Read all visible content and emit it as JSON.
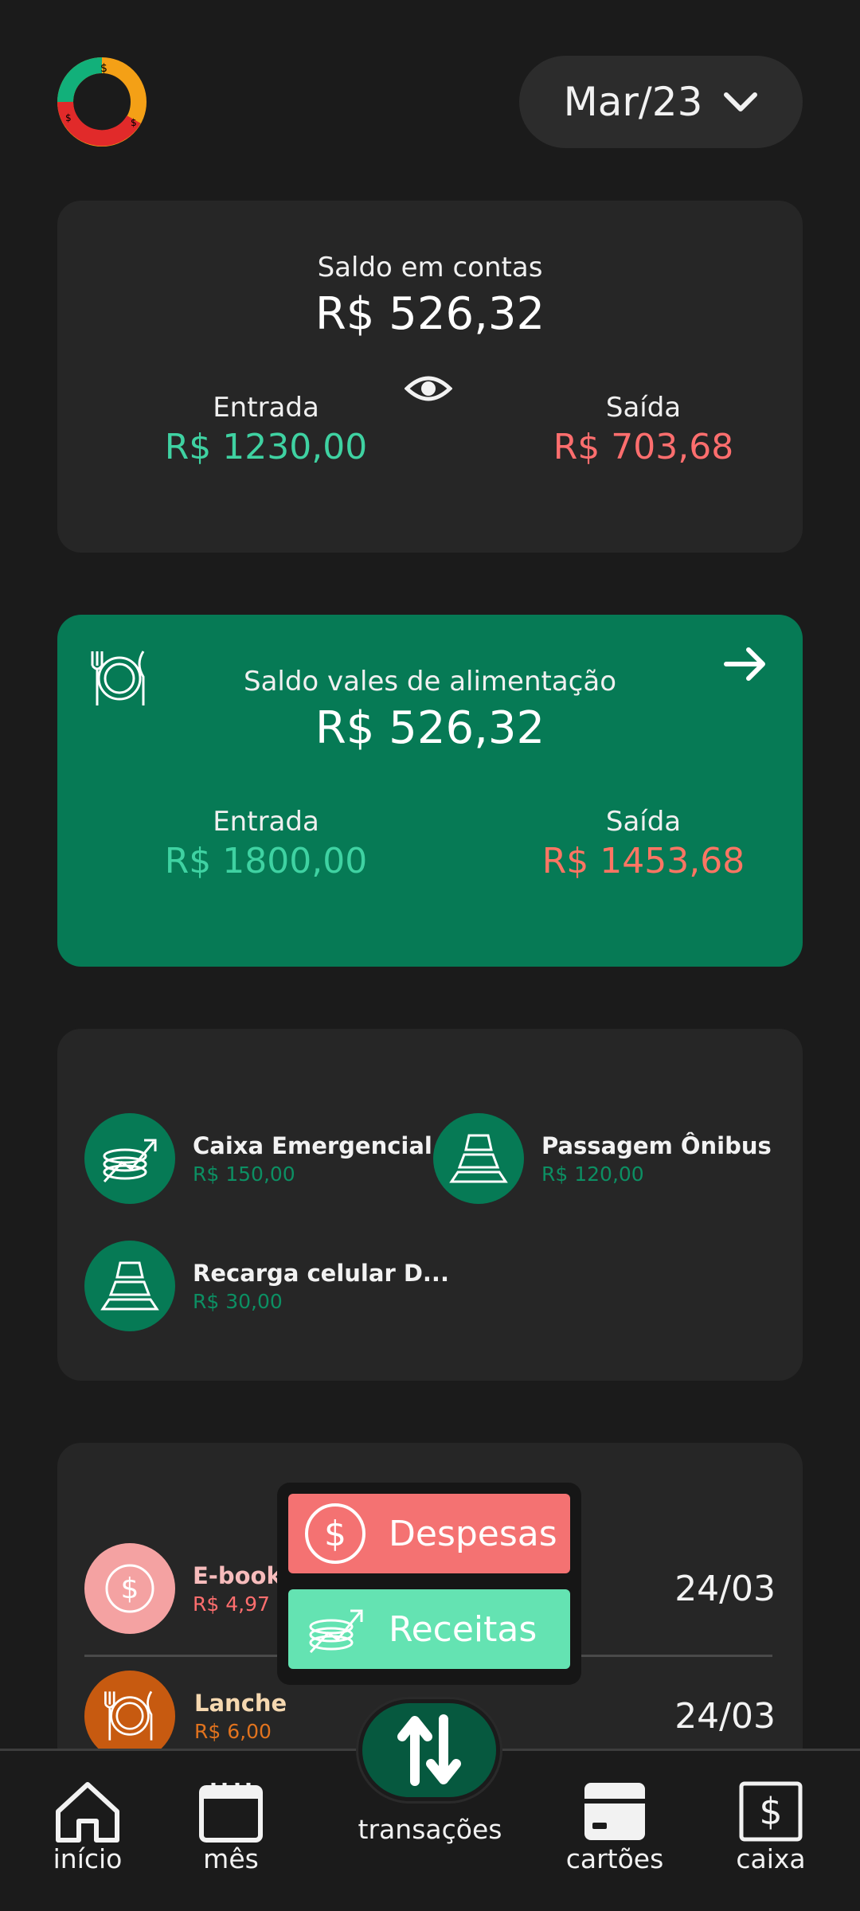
{
  "header": {
    "month": "Mar/23"
  },
  "accounts": {
    "title": "Saldo em contas",
    "balance": "R$ 526,32",
    "in_label": "Entrada",
    "in_value": "R$ 1230,00",
    "out_label": "Saída",
    "out_value": "R$ 703,68"
  },
  "vouchers": {
    "title": "Saldo vales de alimentação",
    "balance": "R$ 526,32",
    "in_label": "Entrada",
    "in_value": "R$ 1800,00",
    "out_label": "Saída",
    "out_value": "R$ 1453,68"
  },
  "boxes": [
    {
      "name": "Caixa Emergencial",
      "amount": "R$ 150,00",
      "icon": "coins-chart-icon"
    },
    {
      "name": "Passagem Ônibus",
      "amount": "R$ 120,00",
      "icon": "pyramid-icon"
    },
    {
      "name": "Recarga celular D...",
      "amount": "R$ 30,00",
      "icon": "pyramid-icon"
    }
  ],
  "transactions": [
    {
      "name": "E-book",
      "amount": "R$ 4,97",
      "date": "24/03",
      "icon": "dollar-icon",
      "color": "#f4a2a2"
    },
    {
      "name": "Lanche",
      "amount": "R$ 6,00",
      "date": "24/03",
      "icon": "plate-icon",
      "color": "#c75a10"
    }
  ],
  "popup": {
    "expenses": "Despesas",
    "income": "Receitas"
  },
  "nav": {
    "home": "início",
    "month": "mês",
    "transactions": "transações",
    "cards": "cartões",
    "cash": "caixa"
  },
  "colors": {
    "accent_green": "#067a55",
    "income_green": "#3fd2a2",
    "expense_red": "#ff6e6e"
  }
}
